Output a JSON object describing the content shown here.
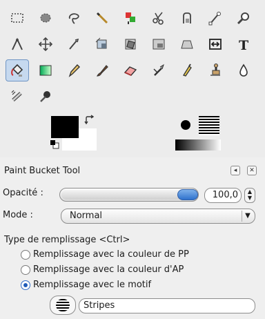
{
  "tools": [
    {
      "name": "rect-select-icon",
      "active": false
    },
    {
      "name": "ellipse-select-icon",
      "active": false
    },
    {
      "name": "free-select-icon",
      "active": false
    },
    {
      "name": "fuzzy-select-icon",
      "active": false
    },
    {
      "name": "by-color-select-icon",
      "active": false
    },
    {
      "name": "scissors-select-icon",
      "active": false
    },
    {
      "name": "foreground-select-icon",
      "active": false
    },
    {
      "name": "paths-icon",
      "active": false
    },
    {
      "name": "zoom-icon",
      "active": false
    },
    {
      "name": "measure-icon",
      "active": false
    },
    {
      "name": "move-icon",
      "active": false
    },
    {
      "name": "alignment-icon",
      "active": false
    },
    {
      "name": "crop-icon",
      "active": false
    },
    {
      "name": "rotate-icon",
      "active": false
    },
    {
      "name": "scale-icon",
      "active": false
    },
    {
      "name": "perspective-icon",
      "active": false
    },
    {
      "name": "flip-icon",
      "active": false
    },
    {
      "name": "text-icon",
      "active": false
    },
    {
      "name": "bucket-fill-icon",
      "active": true
    },
    {
      "name": "blend-icon",
      "active": false
    },
    {
      "name": "pencil-icon",
      "active": false
    },
    {
      "name": "paintbrush-icon",
      "active": false
    },
    {
      "name": "eraser-icon",
      "active": false
    },
    {
      "name": "airbrush-icon",
      "active": false
    },
    {
      "name": "ink-icon",
      "active": false
    },
    {
      "name": "clone-icon",
      "active": false
    },
    {
      "name": "smudge-icon",
      "active": false
    },
    {
      "name": "heal-icon",
      "active": false
    },
    {
      "name": "dodge-burn-icon",
      "active": false
    }
  ],
  "colors": {
    "foreground": "#000000",
    "background": "#ffffff",
    "accent": "#2f72cd"
  },
  "tool_options": {
    "title": "Paint Bucket Tool",
    "opacity_label": "Opacité :",
    "opacity_value": "100,0",
    "opacity_fraction": 1.0,
    "mode_label": "Mode :",
    "mode_value": "Normal",
    "fill_type_label": "Type de remplissage  <Ctrl>",
    "fill_options": [
      {
        "label": "Remplissage avec la couleur de PP",
        "selected": false
      },
      {
        "label": "Remplissage avec la couleur d'AP",
        "selected": false
      },
      {
        "label": "Remplissage avec le motif",
        "selected": true
      }
    ],
    "pattern_name": "Stripes"
  }
}
